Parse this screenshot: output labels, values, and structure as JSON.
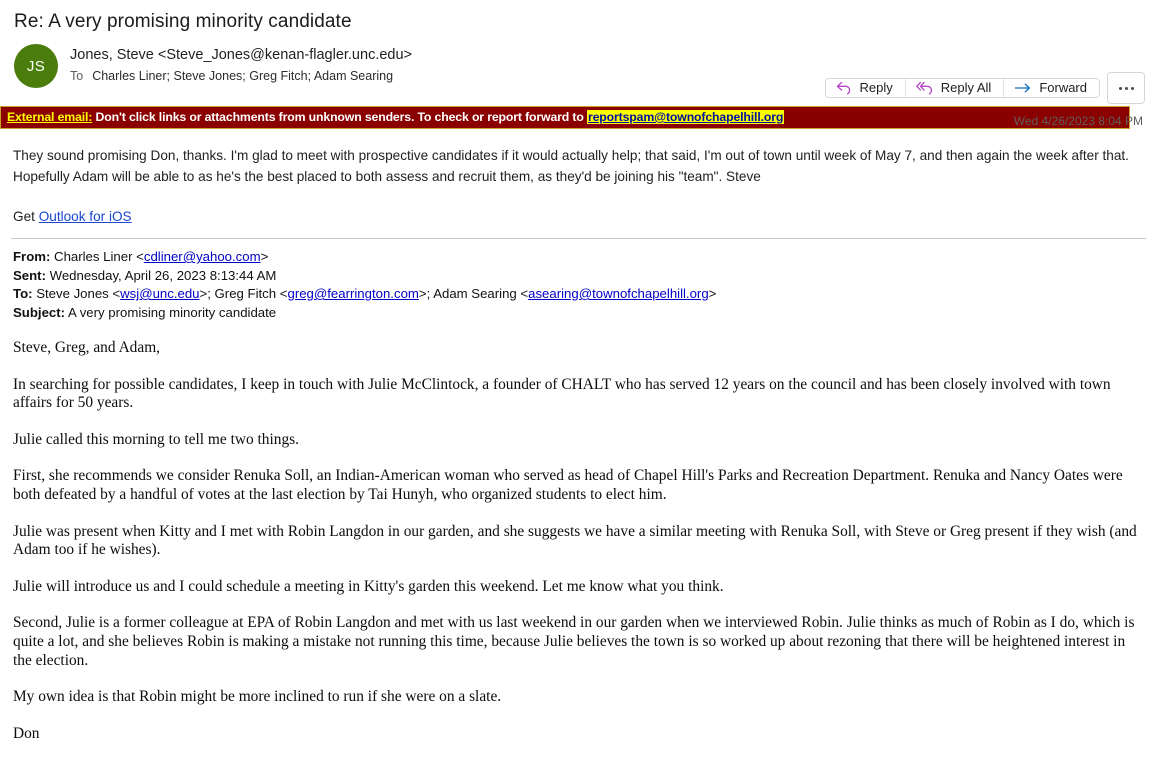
{
  "email": {
    "subject": "Re: A very promising minority candidate",
    "avatar_initials": "JS",
    "avatar_color": "#4a7d0c",
    "sender": "Jones, Steve <Steve_Jones@kenan-flagler.unc.edu>",
    "to_label": "To",
    "recipients": "Charles Liner; Steve Jones; Greg Fitch; Adam Searing",
    "timestamp": "Wed 4/26/2023 8:04 PM"
  },
  "toolbar": {
    "reply_label": "Reply",
    "reply_all_label": "Reply All",
    "forward_label": "Forward",
    "more_label": "•••",
    "reply_icon_color": "#b146c2",
    "forward_icon_color": "#0f6cbd"
  },
  "banner": {
    "label": "External email:",
    "text": " Don't click links or attachments from unknown senders. To check or report forward to ",
    "report_address": "reportspam@townofchapelhill.org",
    "background": "#8a0000",
    "label_color": "#ffff00",
    "highlight_color": "#ffff00",
    "link_color": "#00109f"
  },
  "reply": {
    "paragraph": "They sound promising Don, thanks.  I'm glad to meet with prospective candidates if it would actually help; that said, I'm out of town until week of May 7, and then again the week after that. Hopefully Adam will be able to as he's the best placed to both assess and recruit them, as they'd be joining his \"team\".  Steve",
    "get_prefix": "Get ",
    "outlook_link": "Outlook for iOS"
  },
  "quoted_header": {
    "from_label": "From:",
    "from_name": " Charles Liner <",
    "from_email": "cdliner@yahoo.com",
    "from_close": ">",
    "sent_label": "Sent:",
    "sent_value": " Wednesday, April 26, 2023 8:13:44 AM",
    "to_label": "To:",
    "to_name1": " Steve Jones <",
    "to_email1": "wsj@unc.edu",
    "to_sep1": ">; Greg Fitch <",
    "to_email2": "greg@fearrington.com",
    "to_sep2": ">; Adam Searing <",
    "to_email3": "asearing@townofchapelhill.org",
    "to_close": ">",
    "subject_label": "Subject:",
    "subject_value": " A very promising minority candidate"
  },
  "quoted_body": {
    "paragraphs": [
      "Steve, Greg, and Adam,",
      "In searching for possible candidates, I keep in touch with Julie McClintock, a founder of CHALT who has served 12 years on the council and has been closely involved with town affairs for 50 years.",
      "Julie called this morning to tell me two things.",
      "First, she recommends we consider Renuka Soll, an Indian-American woman who served as head of Chapel Hill's Parks and Recreation Department.  Renuka and Nancy Oates were both defeated by a handful of votes at the last election by Tai Hunyh, who organized students to elect him.",
      "Julie was present when Kitty and I met with Robin Langdon in our garden, and she suggests we have a similar meeting with Renuka Soll, with Steve or Greg present if they wish (and Adam too if he wishes).",
      "Julie will introduce us and I could schedule a meeting in Kitty's garden this weekend.  Let me know what you think.",
      "Second, Julie is a former colleague at EPA of Robin Langdon and met with us last weekend in our garden when we interviewed Robin.  Julie thinks as much of Robin as I do, which is quite a lot, and she believes Robin is making a mistake not running this time, because Julie believes the town is so worked up about rezoning that there will be heightened interest in the election.",
      "My own idea is that Robin might be more inclined to run if she were on a slate.",
      "Don"
    ]
  }
}
